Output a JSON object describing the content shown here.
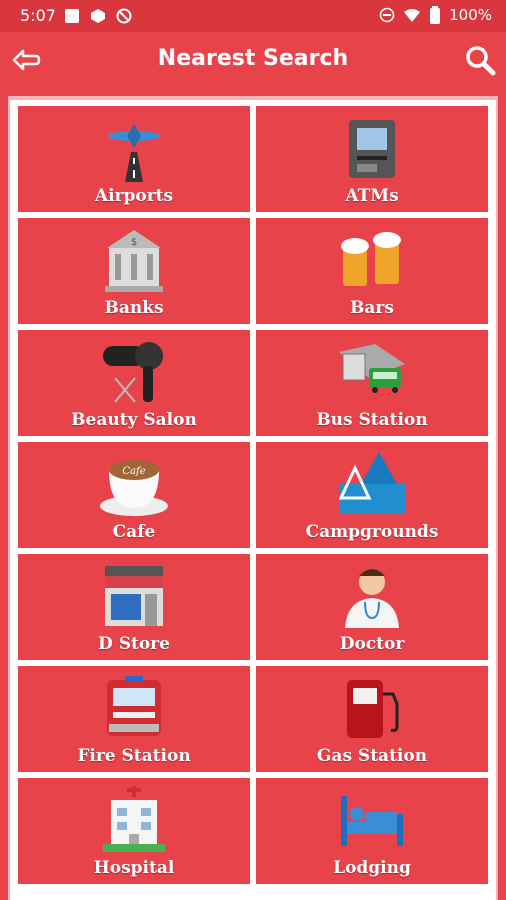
{
  "status_bar": {
    "time": "5:07",
    "battery": "100%"
  },
  "app_bar": {
    "title": "Nearest Search"
  },
  "categories": [
    {
      "label": "Airports",
      "icon": "airport-icon"
    },
    {
      "label": "ATMs",
      "icon": "atm-icon"
    },
    {
      "label": "Banks",
      "icon": "bank-icon"
    },
    {
      "label": "Bars",
      "icon": "beer-mugs-icon"
    },
    {
      "label": "Beauty Salon",
      "icon": "hair-dryer-icon"
    },
    {
      "label": "Bus Station",
      "icon": "bus-station-icon"
    },
    {
      "label": "Cafe",
      "icon": "coffee-cup-icon"
    },
    {
      "label": "Campgrounds",
      "icon": "campground-icon"
    },
    {
      "label": "D Store",
      "icon": "store-icon"
    },
    {
      "label": "Doctor",
      "icon": "doctor-icon"
    },
    {
      "label": "Fire Station",
      "icon": "fire-truck-icon"
    },
    {
      "label": "Gas Station",
      "icon": "gas-pump-icon"
    },
    {
      "label": "Hospital",
      "icon": "hospital-icon"
    },
    {
      "label": "Lodging",
      "icon": "bed-icon"
    }
  ],
  "colors": {
    "primary": "#e8424a",
    "status_bar": "#d9363e",
    "grid_lines": "#ffffff"
  }
}
